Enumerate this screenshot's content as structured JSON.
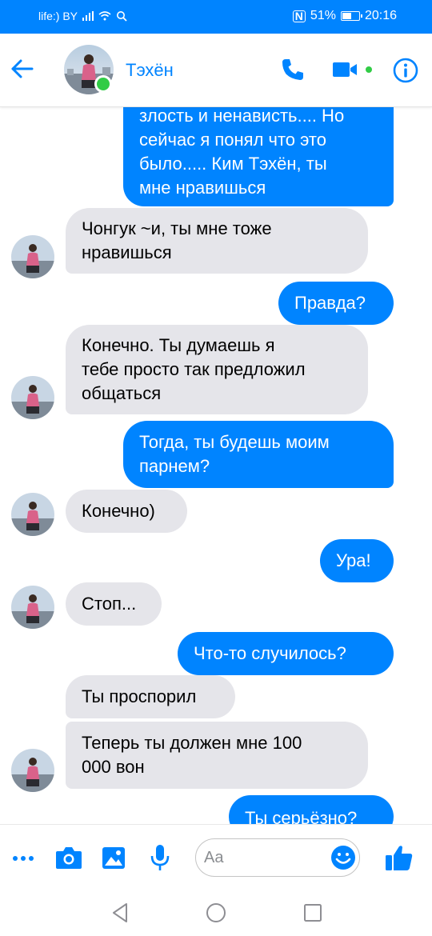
{
  "status_bar": {
    "carrier": "life:) BY",
    "battery_percent": "51%",
    "time": "20:16"
  },
  "header": {
    "contact_name": "Тэхён",
    "online": true
  },
  "messages": [
    {
      "direction": "out",
      "text": "злость и ненависть.... Но\nсейчас я понял что это\nбыло..... Ким Тэхён, ты\nмне нравишься"
    },
    {
      "direction": "in",
      "text": "Чонгук ~и, ты мне тоже\nнравишься"
    },
    {
      "direction": "out",
      "text": "Правда?"
    },
    {
      "direction": "in",
      "text": "Конечно. Ты думаешь я\nтебе просто так предложил\nобщаться"
    },
    {
      "direction": "out",
      "text": "Тогда, ты будешь моим\nпарнем?"
    },
    {
      "direction": "in",
      "text": "Конечно)"
    },
    {
      "direction": "out",
      "text": "Ура!"
    },
    {
      "direction": "in",
      "text": "Стоп..."
    },
    {
      "direction": "out",
      "text": "Что-то  случилось?"
    },
    {
      "direction": "in",
      "text": "Ты проспорил"
    },
    {
      "direction": "in",
      "text": "Теперь ты должен мне 100\n000 вон"
    },
    {
      "direction": "out",
      "text": "Ты серьёзно?"
    }
  ],
  "composer": {
    "placeholder": "Aa"
  },
  "colors": {
    "accent": "#0084ff",
    "incoming_bubble": "#e5e5ea",
    "online": "#31cc46"
  },
  "icons": [
    "back-arrow-icon",
    "phone-icon",
    "video-camera-icon",
    "info-icon",
    "more-icon",
    "camera-icon",
    "image-icon",
    "microphone-icon",
    "emoji-icon",
    "thumbs-up-icon",
    "nav-back-icon",
    "nav-home-icon",
    "nav-recents-icon"
  ]
}
